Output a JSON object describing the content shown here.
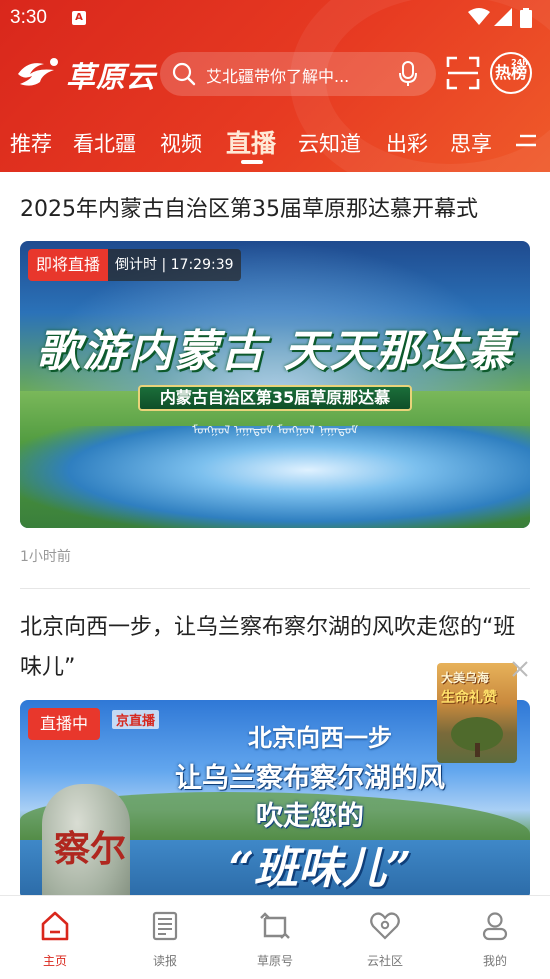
{
  "status_bar": {
    "time": "3:30",
    "notif_letter": "A"
  },
  "header": {
    "logo_text": "草原云",
    "search_placeholder": "艾北疆带你了解中...",
    "hot_label": "热榜",
    "hot_sup": "24h"
  },
  "tabs": [
    {
      "label": "推荐",
      "active": false
    },
    {
      "label": "看北疆",
      "active": false
    },
    {
      "label": "视频",
      "active": false
    },
    {
      "label": "直播",
      "active": true
    },
    {
      "label": "云知道",
      "active": false
    },
    {
      "label": "出彩",
      "active": false
    },
    {
      "label": "思享",
      "active": false
    }
  ],
  "feed": [
    {
      "title": "2025年内蒙古自治区第35届草原那达慕开幕式",
      "badge": "即将直播",
      "countdown": "倒计时 | 17:29:39",
      "poster_headline": "歌游内蒙古  天天那达慕",
      "poster_ribbon": "内蒙古自治区第35届草原那达慕",
      "time_ago": "1小时前"
    },
    {
      "title": "北京向西一步，让乌兰察布察尔湖的风吹走您的“班味儿”",
      "badge": "直播中",
      "poster_channel": "京直播",
      "poster_line1": "北京向西一步",
      "poster_line2": "让乌兰察布察尔湖的风",
      "poster_line3": "吹走您的",
      "poster_line4": "“班味儿”",
      "poster_stone": "察尔"
    }
  ],
  "float_ad": {
    "line1": "大美乌海",
    "line2": "生命礼赞"
  },
  "bottom_nav": [
    {
      "label": "主页",
      "icon": "home-icon",
      "active": true
    },
    {
      "label": "读报",
      "icon": "newspaper-icon",
      "active": false
    },
    {
      "label": "草原号",
      "icon": "square-arrows-icon",
      "active": false
    },
    {
      "label": "云社区",
      "icon": "community-heart-icon",
      "active": false
    },
    {
      "label": "我的",
      "icon": "user-icon",
      "active": false
    }
  ],
  "colors": {
    "brand_red": "#d9271c",
    "live_red": "#e8372c"
  }
}
